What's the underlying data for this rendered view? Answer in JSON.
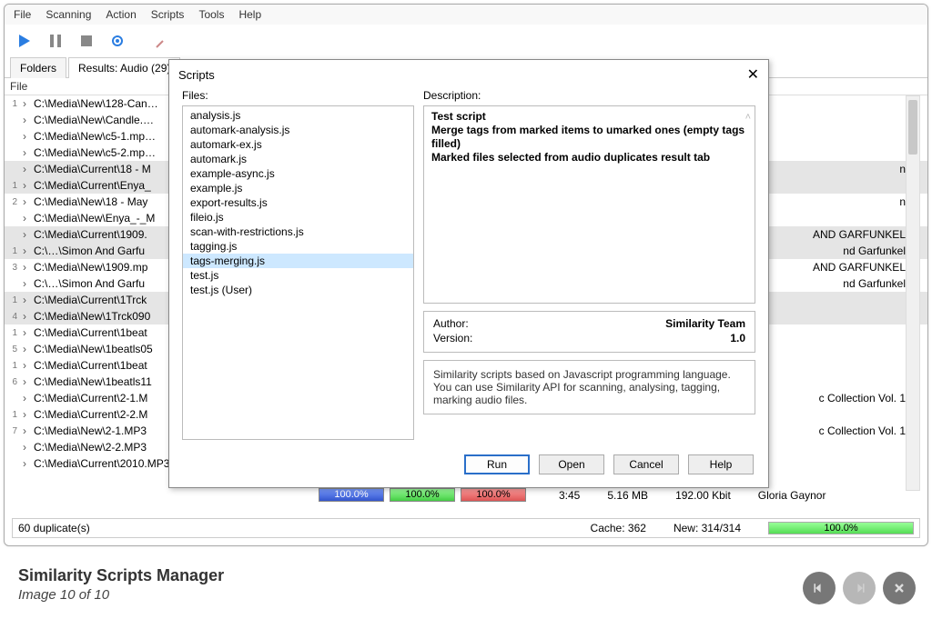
{
  "menubar": [
    "File",
    "Scanning",
    "Action",
    "Scripts",
    "Tools",
    "Help"
  ],
  "tabs": [
    {
      "label": "Folders",
      "active": false
    },
    {
      "label": "Results: Audio (29)",
      "active": true
    }
  ],
  "grid_header": {
    "file": "File"
  },
  "rows": [
    {
      "n": "1",
      "path": "C:\\Media\\New\\128-Can…",
      "tail": ""
    },
    {
      "n": "",
      "path": "C:\\Media\\New\\Candle.…",
      "tail": ""
    },
    {
      "n": "",
      "path": "C:\\Media\\New\\c5-1.mp…",
      "tail": ""
    },
    {
      "n": "",
      "path": "C:\\Media\\New\\c5-2.mp…",
      "tail": ""
    },
    {
      "n": "",
      "path": "C:\\Media\\Current\\18 - M",
      "tail": "n",
      "sel": true
    },
    {
      "n": "1",
      "path": "C:\\Media\\Current\\Enya_",
      "tail": "",
      "sel": true
    },
    {
      "n": "2",
      "path": "C:\\Media\\New\\18 - May",
      "tail": "n"
    },
    {
      "n": "",
      "path": "C:\\Media\\New\\Enya_-_M",
      "tail": ""
    },
    {
      "n": "",
      "path": "C:\\Media\\Current\\1909.",
      "tail": "AND GARFUNKEL",
      "sel": true
    },
    {
      "n": "1",
      "path": "C:\\…\\Simon And Garfu",
      "tail": "nd Garfunkel",
      "sel": true
    },
    {
      "n": "3",
      "path": "C:\\Media\\New\\1909.mp",
      "tail": "AND GARFUNKEL"
    },
    {
      "n": "",
      "path": "C:\\…\\Simon And Garfu",
      "tail": "nd Garfunkel"
    },
    {
      "n": "1",
      "path": "C:\\Media\\Current\\1Trck",
      "tail": "",
      "sel": true
    },
    {
      "n": "4",
      "path": "C:\\Media\\New\\1Trck090",
      "tail": "",
      "sel": true
    },
    {
      "n": "1",
      "path": "C:\\Media\\Current\\1beat",
      "tail": ""
    },
    {
      "n": "5",
      "path": "C:\\Media\\New\\1beatls05",
      "tail": ""
    },
    {
      "n": "1",
      "path": "C:\\Media\\Current\\1beat",
      "tail": ""
    },
    {
      "n": "6",
      "path": "C:\\Media\\New\\1beatls11",
      "tail": ""
    },
    {
      "n": "",
      "path": "C:\\Media\\Current\\2-1.M",
      "tail": "c Collection Vol. 1"
    },
    {
      "n": "1",
      "path": "C:\\Media\\Current\\2-2.M",
      "tail": ""
    },
    {
      "n": "7",
      "path": "C:\\Media\\New\\2-1.MP3",
      "tail": "c Collection Vol. 1"
    },
    {
      "n": "",
      "path": "C:\\Media\\New\\2-2.MP3",
      "tail": ""
    },
    {
      "n": "",
      "path": "C:\\Media\\Current\\2010.MP3",
      "tail": ""
    }
  ],
  "bottom_row": {
    "pct1": "100.0%",
    "pct2": "100.0%",
    "pct3": "100.0%",
    "dur": "3:45",
    "size": "5.16 MB",
    "rate": "192.00 Kbit",
    "artist": "Gloria Gaynor"
  },
  "statusbar": {
    "dupes": "60 duplicate(s)",
    "cache": "Cache: 362",
    "new": "New: 314/314",
    "progress": "100.0%"
  },
  "dialog": {
    "title": "Scripts",
    "files_label": "Files:",
    "desc_label": "Description:",
    "files": [
      "analysis.js",
      "automark-analysis.js",
      "automark-ex.js",
      "automark.js",
      "example-async.js",
      "example.js",
      "export-results.js",
      "fileio.js",
      "scan-with-restrictions.js",
      "tagging.js",
      "tags-merging.js",
      "test.js",
      "test.js (User)"
    ],
    "selected_index": 10,
    "description": [
      "Test script",
      "Merge tags from marked items to umarked ones (empty tags filled)",
      "Marked files selected from audio duplicates result tab"
    ],
    "author_label": "Author:",
    "author": "Similarity Team",
    "version_label": "Version:",
    "version": "1.0",
    "info": "Similarity scripts based on Javascript programming language. You can use Similarity API for scanning, analysing, tagging, marking audio files.",
    "buttons": {
      "run": "Run",
      "open": "Open",
      "cancel": "Cancel",
      "help": "Help"
    }
  },
  "caption": {
    "title": "Similarity Scripts Manager",
    "sub": "Image 10 of 10"
  }
}
